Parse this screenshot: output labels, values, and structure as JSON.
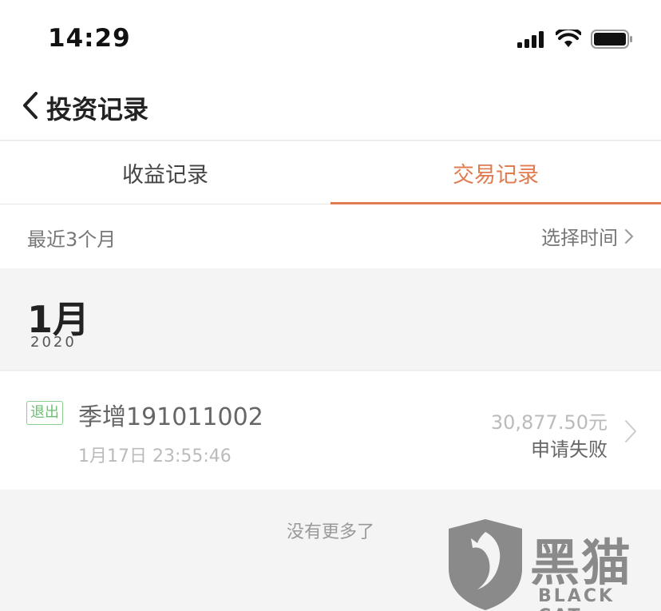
{
  "status_bar": {
    "time": "14:29"
  },
  "nav": {
    "title": "投资记录"
  },
  "tabs": [
    {
      "label": "收益记录",
      "active": false
    },
    {
      "label": "交易记录",
      "active": true
    }
  ],
  "filter": {
    "range": "最近3个月",
    "select_time": "选择时间"
  },
  "month_group": {
    "month": "1月",
    "year": "2020"
  },
  "records": [
    {
      "badge": "退出",
      "name": "季增191011002",
      "time": "1月17日 23:55:46",
      "amount": "30,877.50元",
      "status": "申请失败"
    }
  ],
  "footer": {
    "no_more": "没有更多了"
  },
  "watermark": {
    "title": "黑猫",
    "subtitle": "BLACK CAT"
  },
  "colors": {
    "accent": "#e07b52",
    "badge_green": "#6cbf73"
  }
}
